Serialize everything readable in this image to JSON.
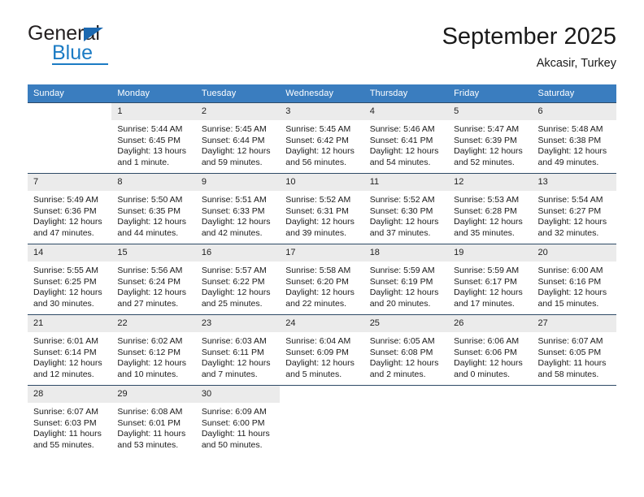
{
  "brand": {
    "name_top": "General",
    "name_bottom": "Blue",
    "triangle_icon": "triangle-icon",
    "accent_color": "#1b7bc4"
  },
  "header": {
    "title": "September 2025",
    "subtitle": "Akcasir, Turkey"
  },
  "calendar": {
    "header_bg": "#3a7dbf",
    "daynum_bg": "#ebebeb",
    "weekday_headers": [
      "Sunday",
      "Monday",
      "Tuesday",
      "Wednesday",
      "Thursday",
      "Friday",
      "Saturday"
    ],
    "labels": {
      "sunrise": "Sunrise:",
      "sunset": "Sunset:",
      "daylight": "Daylight:"
    },
    "weeks": [
      [
        {
          "day": "",
          "sunrise": "",
          "sunset": "",
          "daylight": ""
        },
        {
          "day": "1",
          "sunrise": "Sunrise: 5:44 AM",
          "sunset": "Sunset: 6:45 PM",
          "daylight": "Daylight: 13 hours and 1 minute."
        },
        {
          "day": "2",
          "sunrise": "Sunrise: 5:45 AM",
          "sunset": "Sunset: 6:44 PM",
          "daylight": "Daylight: 12 hours and 59 minutes."
        },
        {
          "day": "3",
          "sunrise": "Sunrise: 5:45 AM",
          "sunset": "Sunset: 6:42 PM",
          "daylight": "Daylight: 12 hours and 56 minutes."
        },
        {
          "day": "4",
          "sunrise": "Sunrise: 5:46 AM",
          "sunset": "Sunset: 6:41 PM",
          "daylight": "Daylight: 12 hours and 54 minutes."
        },
        {
          "day": "5",
          "sunrise": "Sunrise: 5:47 AM",
          "sunset": "Sunset: 6:39 PM",
          "daylight": "Daylight: 12 hours and 52 minutes."
        },
        {
          "day": "6",
          "sunrise": "Sunrise: 5:48 AM",
          "sunset": "Sunset: 6:38 PM",
          "daylight": "Daylight: 12 hours and 49 minutes."
        }
      ],
      [
        {
          "day": "7",
          "sunrise": "Sunrise: 5:49 AM",
          "sunset": "Sunset: 6:36 PM",
          "daylight": "Daylight: 12 hours and 47 minutes."
        },
        {
          "day": "8",
          "sunrise": "Sunrise: 5:50 AM",
          "sunset": "Sunset: 6:35 PM",
          "daylight": "Daylight: 12 hours and 44 minutes."
        },
        {
          "day": "9",
          "sunrise": "Sunrise: 5:51 AM",
          "sunset": "Sunset: 6:33 PM",
          "daylight": "Daylight: 12 hours and 42 minutes."
        },
        {
          "day": "10",
          "sunrise": "Sunrise: 5:52 AM",
          "sunset": "Sunset: 6:31 PM",
          "daylight": "Daylight: 12 hours and 39 minutes."
        },
        {
          "day": "11",
          "sunrise": "Sunrise: 5:52 AM",
          "sunset": "Sunset: 6:30 PM",
          "daylight": "Daylight: 12 hours and 37 minutes."
        },
        {
          "day": "12",
          "sunrise": "Sunrise: 5:53 AM",
          "sunset": "Sunset: 6:28 PM",
          "daylight": "Daylight: 12 hours and 35 minutes."
        },
        {
          "day": "13",
          "sunrise": "Sunrise: 5:54 AM",
          "sunset": "Sunset: 6:27 PM",
          "daylight": "Daylight: 12 hours and 32 minutes."
        }
      ],
      [
        {
          "day": "14",
          "sunrise": "Sunrise: 5:55 AM",
          "sunset": "Sunset: 6:25 PM",
          "daylight": "Daylight: 12 hours and 30 minutes."
        },
        {
          "day": "15",
          "sunrise": "Sunrise: 5:56 AM",
          "sunset": "Sunset: 6:24 PM",
          "daylight": "Daylight: 12 hours and 27 minutes."
        },
        {
          "day": "16",
          "sunrise": "Sunrise: 5:57 AM",
          "sunset": "Sunset: 6:22 PM",
          "daylight": "Daylight: 12 hours and 25 minutes."
        },
        {
          "day": "17",
          "sunrise": "Sunrise: 5:58 AM",
          "sunset": "Sunset: 6:20 PM",
          "daylight": "Daylight: 12 hours and 22 minutes."
        },
        {
          "day": "18",
          "sunrise": "Sunrise: 5:59 AM",
          "sunset": "Sunset: 6:19 PM",
          "daylight": "Daylight: 12 hours and 20 minutes."
        },
        {
          "day": "19",
          "sunrise": "Sunrise: 5:59 AM",
          "sunset": "Sunset: 6:17 PM",
          "daylight": "Daylight: 12 hours and 17 minutes."
        },
        {
          "day": "20",
          "sunrise": "Sunrise: 6:00 AM",
          "sunset": "Sunset: 6:16 PM",
          "daylight": "Daylight: 12 hours and 15 minutes."
        }
      ],
      [
        {
          "day": "21",
          "sunrise": "Sunrise: 6:01 AM",
          "sunset": "Sunset: 6:14 PM",
          "daylight": "Daylight: 12 hours and 12 minutes."
        },
        {
          "day": "22",
          "sunrise": "Sunrise: 6:02 AM",
          "sunset": "Sunset: 6:12 PM",
          "daylight": "Daylight: 12 hours and 10 minutes."
        },
        {
          "day": "23",
          "sunrise": "Sunrise: 6:03 AM",
          "sunset": "Sunset: 6:11 PM",
          "daylight": "Daylight: 12 hours and 7 minutes."
        },
        {
          "day": "24",
          "sunrise": "Sunrise: 6:04 AM",
          "sunset": "Sunset: 6:09 PM",
          "daylight": "Daylight: 12 hours and 5 minutes."
        },
        {
          "day": "25",
          "sunrise": "Sunrise: 6:05 AM",
          "sunset": "Sunset: 6:08 PM",
          "daylight": "Daylight: 12 hours and 2 minutes."
        },
        {
          "day": "26",
          "sunrise": "Sunrise: 6:06 AM",
          "sunset": "Sunset: 6:06 PM",
          "daylight": "Daylight: 12 hours and 0 minutes."
        },
        {
          "day": "27",
          "sunrise": "Sunrise: 6:07 AM",
          "sunset": "Sunset: 6:05 PM",
          "daylight": "Daylight: 11 hours and 58 minutes."
        }
      ],
      [
        {
          "day": "28",
          "sunrise": "Sunrise: 6:07 AM",
          "sunset": "Sunset: 6:03 PM",
          "daylight": "Daylight: 11 hours and 55 minutes."
        },
        {
          "day": "29",
          "sunrise": "Sunrise: 6:08 AM",
          "sunset": "Sunset: 6:01 PM",
          "daylight": "Daylight: 11 hours and 53 minutes."
        },
        {
          "day": "30",
          "sunrise": "Sunrise: 6:09 AM",
          "sunset": "Sunset: 6:00 PM",
          "daylight": "Daylight: 11 hours and 50 minutes."
        },
        {
          "day": "",
          "sunrise": "",
          "sunset": "",
          "daylight": ""
        },
        {
          "day": "",
          "sunrise": "",
          "sunset": "",
          "daylight": ""
        },
        {
          "day": "",
          "sunrise": "",
          "sunset": "",
          "daylight": ""
        },
        {
          "day": "",
          "sunrise": "",
          "sunset": "",
          "daylight": ""
        }
      ]
    ]
  }
}
